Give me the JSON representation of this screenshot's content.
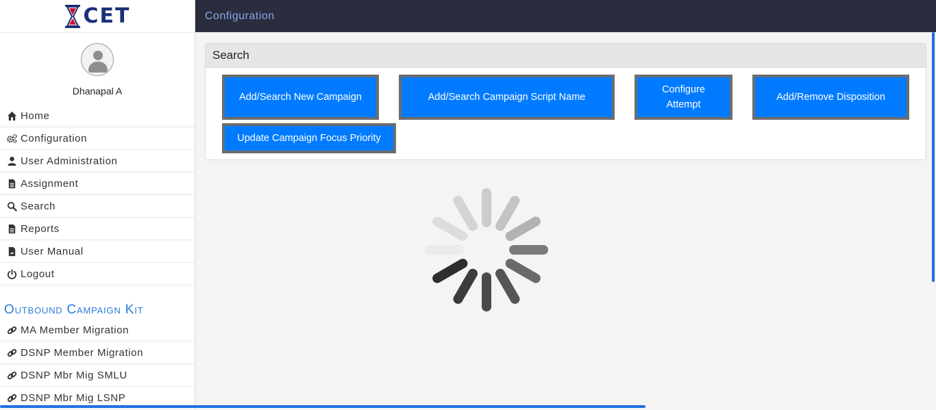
{
  "brand": {
    "logo_text": "CET"
  },
  "user": {
    "name": "Dhanapal A"
  },
  "nav": [
    {
      "label": "Home",
      "icon": "home-icon"
    },
    {
      "label": "Configuration",
      "icon": "gears-icon"
    },
    {
      "label": "User Administration",
      "icon": "user-icon"
    },
    {
      "label": "Assignment",
      "icon": "file-icon"
    },
    {
      "label": "Search",
      "icon": "search-icon"
    },
    {
      "label": "Reports",
      "icon": "file-icon"
    },
    {
      "label": "User Manual",
      "icon": "pdf-icon"
    },
    {
      "label": "Logout",
      "icon": "power-icon"
    }
  ],
  "kit": {
    "title": "Outbound Campaign Kit",
    "items": [
      {
        "label": "MA Member Migration",
        "icon": "link-icon"
      },
      {
        "label": "DSNP Member Migration",
        "icon": "link-icon"
      },
      {
        "label": "DSNP Mbr Mig SMLU",
        "icon": "link-icon"
      },
      {
        "label": "DSNP Mbr Mig LSNP",
        "icon": "link-icon"
      }
    ]
  },
  "header": {
    "title": "Configuration"
  },
  "panel": {
    "title": "Search",
    "buttons": {
      "add_campaign": "Add/Search New Campaign",
      "add_script": "Add/Search Campaign Script Name",
      "configure_attempt": "Configure Attempt",
      "disposition": "Add/Remove Disposition",
      "focus_priority": "Update Campaign Focus Priority"
    }
  },
  "colors": {
    "accent": "#007bff",
    "header_bg": "#2a2d3e",
    "kit_title": "#2a7cdc",
    "logo": "#1c2f78"
  }
}
